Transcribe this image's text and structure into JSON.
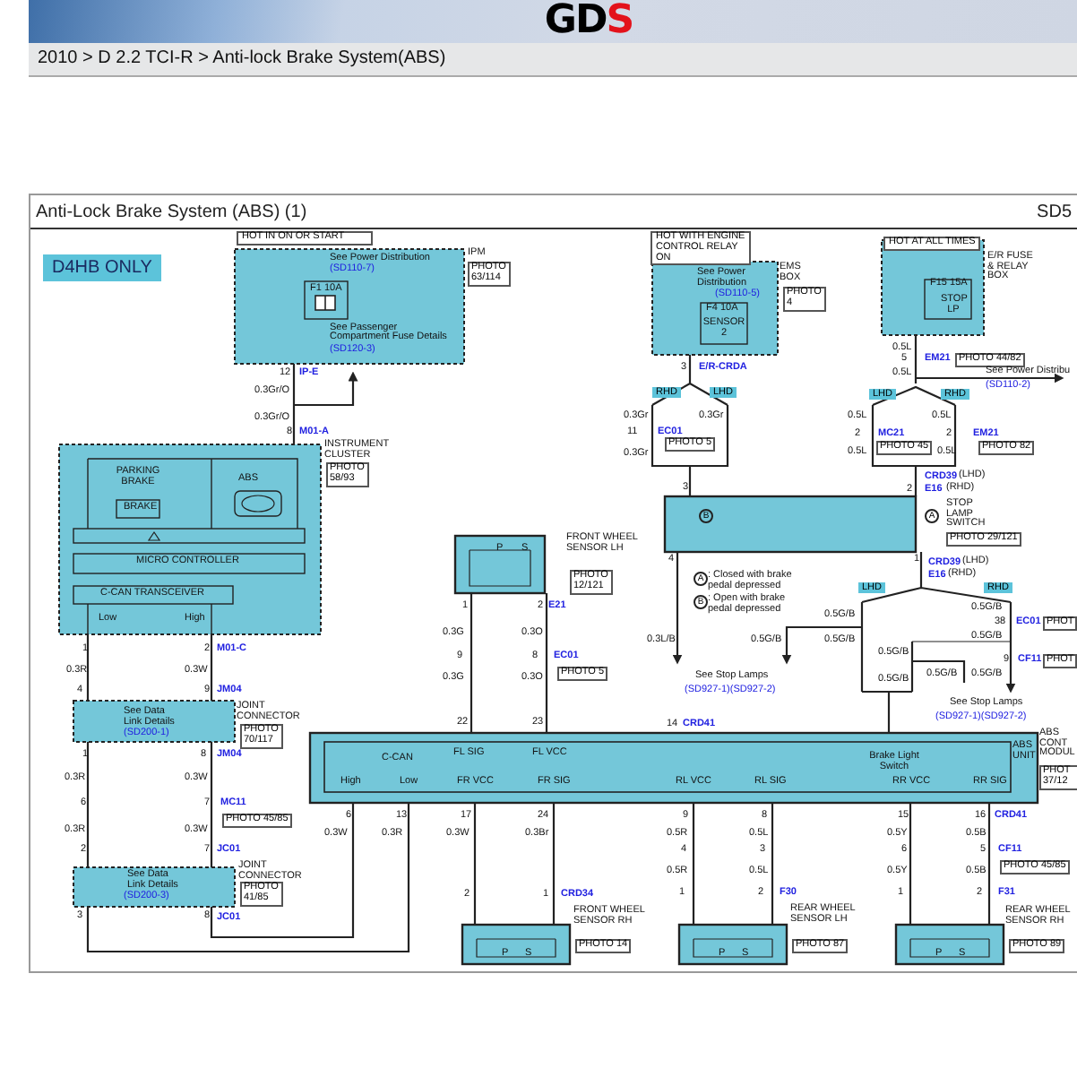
{
  "header": {
    "logo_main": "GD",
    "logo_accent": "S"
  },
  "breadcrumb": "2010 > D 2.2 TCI-R > Anti-lock Brake System(ABS)",
  "diagram": {
    "title": "Anti-Lock Brake System (ABS) (1)",
    "code": "SD5",
    "badge": "D4HB ONLY",
    "labels": [
      {
        "kind": "note",
        "text": "HOT IN ON OR START"
      },
      {
        "kind": "see",
        "text": "See Power Distribution"
      },
      {
        "kind": "link",
        "text": "(SD110-7)"
      },
      {
        "kind": "inner",
        "text": "F1 10A"
      },
      {
        "kind": "see",
        "text": "See Passenger"
      },
      {
        "kind": "see",
        "text": "Compartment Fuse Details"
      },
      {
        "kind": "link",
        "text": "(SD120-3)"
      },
      {
        "kind": "comp",
        "text": "IPM"
      },
      {
        "kind": "photo",
        "text": "PHOTO 63/114"
      },
      {
        "kind": "pin",
        "text": "12"
      },
      {
        "kind": "conn",
        "text": "IP-E"
      },
      {
        "kind": "wire",
        "text": "0.3Gr/O"
      },
      {
        "kind": "wire",
        "text": "0.3Gr/O"
      },
      {
        "kind": "pin",
        "text": "8"
      },
      {
        "kind": "conn",
        "text": "M01-A"
      },
      {
        "kind": "inner",
        "text": "PARKING BRAKE"
      },
      {
        "kind": "inner",
        "text": "BRAKE"
      },
      {
        "kind": "inner",
        "text": "ABS"
      },
      {
        "kind": "comp",
        "text": "INSTRUMENT CLUSTER"
      },
      {
        "kind": "photo",
        "text": "PHOTO 58/93"
      },
      {
        "kind": "inner",
        "text": "MICRO CONTROLLER"
      },
      {
        "kind": "inner",
        "text": "C-CAN TRANSCEIVER"
      },
      {
        "kind": "inner",
        "text": "Low"
      },
      {
        "kind": "inner",
        "text": "High"
      },
      {
        "kind": "pin",
        "text": "1"
      },
      {
        "kind": "pin",
        "text": "2"
      },
      {
        "kind": "conn",
        "text": "M01-C"
      },
      {
        "kind": "wire",
        "text": "0.3R"
      },
      {
        "kind": "wire",
        "text": "0.3W"
      },
      {
        "kind": "pin",
        "text": "4"
      },
      {
        "kind": "pin",
        "text": "9"
      },
      {
        "kind": "conn",
        "text": "JM04"
      },
      {
        "kind": "see",
        "text": "See Data Link Details"
      },
      {
        "kind": "link",
        "text": "(SD200-1)"
      },
      {
        "kind": "comp",
        "text": "JOINT CONNECTOR"
      },
      {
        "kind": "photo",
        "text": "PHOTO 70/117"
      },
      {
        "kind": "pin",
        "text": "1"
      },
      {
        "kind": "pin",
        "text": "8"
      },
      {
        "kind": "conn",
        "text": "JM04"
      },
      {
        "kind": "wire",
        "text": "0.3R"
      },
      {
        "kind": "wire",
        "text": "0.3W"
      },
      {
        "kind": "pin",
        "text": "6"
      },
      {
        "kind": "pin",
        "text": "7"
      },
      {
        "kind": "conn",
        "text": "MC11"
      },
      {
        "kind": "photo",
        "text": "PHOTO 45/85"
      },
      {
        "kind": "wire",
        "text": "0.3R"
      },
      {
        "kind": "wire",
        "text": "0.3W"
      },
      {
        "kind": "pin",
        "text": "2"
      },
      {
        "kind": "pin",
        "text": "7"
      },
      {
        "kind": "conn",
        "text": "JC01"
      },
      {
        "kind": "comp",
        "text": "JOINT CONNECTOR"
      },
      {
        "kind": "photo",
        "text": "PHOTO 41/85"
      },
      {
        "kind": "see",
        "text": "See Data Link Details"
      },
      {
        "kind": "link",
        "text": "(SD200-3)"
      },
      {
        "kind": "pin",
        "text": "3"
      },
      {
        "kind": "pin",
        "text": "8"
      },
      {
        "kind": "conn",
        "text": "JC01"
      },
      {
        "kind": "inner",
        "text": "C-CAN"
      },
      {
        "kind": "inner",
        "text": "High"
      },
      {
        "kind": "inner",
        "text": "Low"
      },
      {
        "kind": "inner",
        "text": "FL SIG"
      },
      {
        "kind": "inner",
        "text": "FL VCC"
      },
      {
        "kind": "inner",
        "text": "Brake Light Switch"
      },
      {
        "kind": "inner",
        "text": "FR VCC"
      },
      {
        "kind": "inner",
        "text": "FR SIG"
      },
      {
        "kind": "inner",
        "text": "RL VCC"
      },
      {
        "kind": "inner",
        "text": "RL SIG"
      },
      {
        "kind": "inner",
        "text": "RR VCC"
      },
      {
        "kind": "inner",
        "text": "RR SIG"
      },
      {
        "kind": "comp",
        "text": "ABS UNIT"
      },
      {
        "kind": "comp",
        "text": "ABS CONT MODUL"
      },
      {
        "kind": "photo",
        "text": "PHOT 37/12"
      },
      {
        "kind": "pin",
        "text": "22"
      },
      {
        "kind": "pin",
        "text": "23"
      },
      {
        "kind": "pin",
        "text": "14"
      },
      {
        "kind": "conn",
        "text": "CRD41"
      },
      {
        "kind": "pin",
        "text": "6"
      },
      {
        "kind": "pin",
        "text": "13"
      },
      {
        "kind": "pin",
        "text": "17"
      },
      {
        "kind": "pin",
        "text": "24"
      },
      {
        "kind": "pin",
        "text": "9"
      },
      {
        "kind": "pin",
        "text": "8"
      },
      {
        "kind": "pin",
        "text": "15"
      },
      {
        "kind": "pin",
        "text": "16"
      },
      {
        "kind": "conn",
        "text": "CRD41"
      },
      {
        "kind": "wire",
        "text": "0.3W"
      },
      {
        "kind": "wire",
        "text": "0.3R"
      },
      {
        "kind": "wire",
        "text": "0.3W"
      },
      {
        "kind": "wire",
        "text": "0.3Br"
      },
      {
        "kind": "wire",
        "text": "0.5R"
      },
      {
        "kind": "wire",
        "text": "0.5L"
      },
      {
        "kind": "wire",
        "text": "0.5Y"
      },
      {
        "kind": "wire",
        "text": "0.5B"
      },
      {
        "kind": "pin",
        "text": "4"
      },
      {
        "kind": "pin",
        "text": "3"
      },
      {
        "kind": "pin",
        "text": "6"
      },
      {
        "kind": "pin",
        "text": "5"
      },
      {
        "kind": "conn",
        "text": "CF11"
      },
      {
        "kind": "photo",
        "text": "PHOTO 45/85"
      },
      {
        "kind": "wire",
        "text": "0.5R"
      },
      {
        "kind": "wire",
        "text": "0.5L"
      },
      {
        "kind": "wire",
        "text": "0.5Y"
      },
      {
        "kind": "wire",
        "text": "0.5B"
      },
      {
        "kind": "pin",
        "text": "2"
      },
      {
        "kind": "pin",
        "text": "1"
      },
      {
        "kind": "conn",
        "text": "CRD34"
      },
      {
        "kind": "pin",
        "text": "1"
      },
      {
        "kind": "pin",
        "text": "2"
      },
      {
        "kind": "conn",
        "text": "F30"
      },
      {
        "kind": "pin",
        "text": "1"
      },
      {
        "kind": "pin",
        "text": "2"
      },
      {
        "kind": "conn",
        "text": "F31"
      },
      {
        "kind": "comp",
        "text": "FRONT WHEEL SENSOR RH"
      },
      {
        "kind": "photo",
        "text": "PHOTO 14"
      },
      {
        "kind": "comp",
        "text": "REAR WHEEL SENSOR LH"
      },
      {
        "kind": "photo",
        "text": "PHOTO 87"
      },
      {
        "kind": "comp",
        "text": "REAR WHEEL SENSOR RH"
      },
      {
        "kind": "photo",
        "text": "PHOTO 89"
      },
      {
        "kind": "inner",
        "text": "P"
      },
      {
        "kind": "inner",
        "text": "S"
      },
      {
        "kind": "inner",
        "text": "P"
      },
      {
        "kind": "inner",
        "text": "S"
      },
      {
        "kind": "inner",
        "text": "P"
      },
      {
        "kind": "inner",
        "text": "S"
      },
      {
        "kind": "inner",
        "text": "P"
      },
      {
        "kind": "inner",
        "text": "S"
      },
      {
        "kind": "comp",
        "text": "FRONT WHEEL SENSOR LH"
      },
      {
        "kind": "photo",
        "text": "PHOTO 12/121"
      },
      {
        "kind": "pin",
        "text": "1"
      },
      {
        "kind": "pin",
        "text": "2"
      },
      {
        "kind": "conn",
        "text": "E21"
      },
      {
        "kind": "wire",
        "text": "0.3G"
      },
      {
        "kind": "wire",
        "text": "0.3O"
      },
      {
        "kind": "pin",
        "text": "9"
      },
      {
        "kind": "pin",
        "text": "8"
      },
      {
        "kind": "conn",
        "text": "EC01"
      },
      {
        "kind": "photo",
        "text": "PHOTO 5"
      },
      {
        "kind": "wire",
        "text": "0.3G"
      },
      {
        "kind": "wire",
        "text": "0.3O"
      },
      {
        "kind": "note",
        "text": "HOT WITH ENGINE CONTROL RELAY ON"
      },
      {
        "kind": "see",
        "text": "See Power Distribution"
      },
      {
        "kind": "link",
        "text": "(SD110-5)"
      },
      {
        "kind": "inner",
        "text": "F4 10A"
      },
      {
        "kind": "inner",
        "text": "SENSOR 2"
      },
      {
        "kind": "comp",
        "text": "EMS BOX"
      },
      {
        "kind": "photo",
        "text": "PHOTO 4"
      },
      {
        "kind": "pin",
        "text": "3"
      },
      {
        "kind": "conn",
        "text": "E/R-CRDA"
      },
      {
        "kind": "tag",
        "text": "RHD"
      },
      {
        "kind": "tag",
        "text": "LHD"
      },
      {
        "kind": "wire",
        "text": "0.3Gr"
      },
      {
        "kind": "wire",
        "text": "0.3Gr"
      },
      {
        "kind": "pin",
        "text": "11"
      },
      {
        "kind": "conn",
        "text": "EC01"
      },
      {
        "kind": "photo",
        "text": "PHOTO 5"
      },
      {
        "kind": "wire",
        "text": "0.3Gr"
      },
      {
        "kind": "pin",
        "text": "3"
      },
      {
        "kind": "note",
        "text": "HOT AT ALL TIMES"
      },
      {
        "kind": "inner",
        "text": "F15 15A"
      },
      {
        "kind": "inner",
        "text": "STOP LP"
      },
      {
        "kind": "comp",
        "text": "E/R FUSE & RELAY BOX"
      },
      {
        "kind": "wire",
        "text": "0.5L"
      },
      {
        "kind": "pin",
        "text": "5"
      },
      {
        "kind": "conn",
        "text": "EM21"
      },
      {
        "kind": "photo",
        "text": "PHOTO 44/82"
      },
      {
        "kind": "wire",
        "text": "0.5L"
      },
      {
        "kind": "see",
        "text": "See Power Distribu"
      },
      {
        "kind": "link",
        "text": "(SD110-2)"
      },
      {
        "kind": "tag",
        "text": "LHD"
      },
      {
        "kind": "tag",
        "text": "RHD"
      },
      {
        "kind": "wire",
        "text": "0.5L"
      },
      {
        "kind": "wire",
        "text": "0.5L"
      },
      {
        "kind": "pin",
        "text": "2"
      },
      {
        "kind": "conn",
        "text": "MC21"
      },
      {
        "kind": "photo",
        "text": "PHOTO 45"
      },
      {
        "kind": "pin",
        "text": "2"
      },
      {
        "kind": "conn",
        "text": "EM21"
      },
      {
        "kind": "photo",
        "text": "PHOTO 82"
      },
      {
        "kind": "wire",
        "text": "0.5L"
      },
      {
        "kind": "wire",
        "text": "0.5L"
      },
      {
        "kind": "pin",
        "text": "2"
      },
      {
        "kind": "conn",
        "text": "CRD39"
      },
      {
        "kind": "see",
        "text": "(LHD)"
      },
      {
        "kind": "conn",
        "text": "E16"
      },
      {
        "kind": "see",
        "text": "(RHD)"
      },
      {
        "kind": "comp",
        "text": "STOP LAMP SWITCH"
      },
      {
        "kind": "photo",
        "text": "PHOTO 29/121"
      },
      {
        "kind": "circ",
        "text": "B"
      },
      {
        "kind": "circ",
        "text": "A"
      },
      {
        "kind": "pin",
        "text": "4"
      },
      {
        "kind": "pin",
        "text": "1"
      },
      {
        "kind": "conn",
        "text": "CRD39"
      },
      {
        "kind": "see",
        "text": "(LHD)"
      },
      {
        "kind": "conn",
        "text": "E16"
      },
      {
        "kind": "see",
        "text": "(RHD)"
      },
      {
        "kind": "circ",
        "text": "A"
      },
      {
        "kind": "see",
        "text": ": Closed with brake pedal depressed"
      },
      {
        "kind": "circ",
        "text": "B"
      },
      {
        "kind": "see",
        "text": ": Open with brake pedal depressed"
      },
      {
        "kind": "tag",
        "text": "LHD"
      },
      {
        "kind": "tag",
        "text": "RHD"
      },
      {
        "kind": "wire",
        "text": "0.3L/B"
      },
      {
        "kind": "wire",
        "text": "0.5G/B"
      },
      {
        "kind": "wire",
        "text": "0.5G/B"
      },
      {
        "kind": "wire",
        "text": "0.5G/B"
      },
      {
        "kind": "see",
        "text": "See Stop Lamps"
      },
      {
        "kind": "link",
        "text": "(SD927-1)(SD927-2)"
      },
      {
        "kind": "wire",
        "text": "0.5G/B"
      },
      {
        "kind": "pin",
        "text": "38"
      },
      {
        "kind": "conn",
        "text": "EC01"
      },
      {
        "kind": "photo",
        "text": "PHOT"
      },
      {
        "kind": "wire",
        "text": "0.5G/B"
      },
      {
        "kind": "wire",
        "text": "0.5G/B"
      },
      {
        "kind": "pin",
        "text": "9"
      },
      {
        "kind": "conn",
        "text": "CF11"
      },
      {
        "kind": "photo",
        "text": "PHOT"
      },
      {
        "kind": "wire",
        "text": "0.5G/B"
      },
      {
        "kind": "wire",
        "text": "0.5G/B"
      },
      {
        "kind": "wire",
        "text": "0.5G/B"
      },
      {
        "kind": "see",
        "text": "See Stop Lamps"
      },
      {
        "kind": "link",
        "text": "(SD927-1)(SD927-2)"
      }
    ]
  }
}
